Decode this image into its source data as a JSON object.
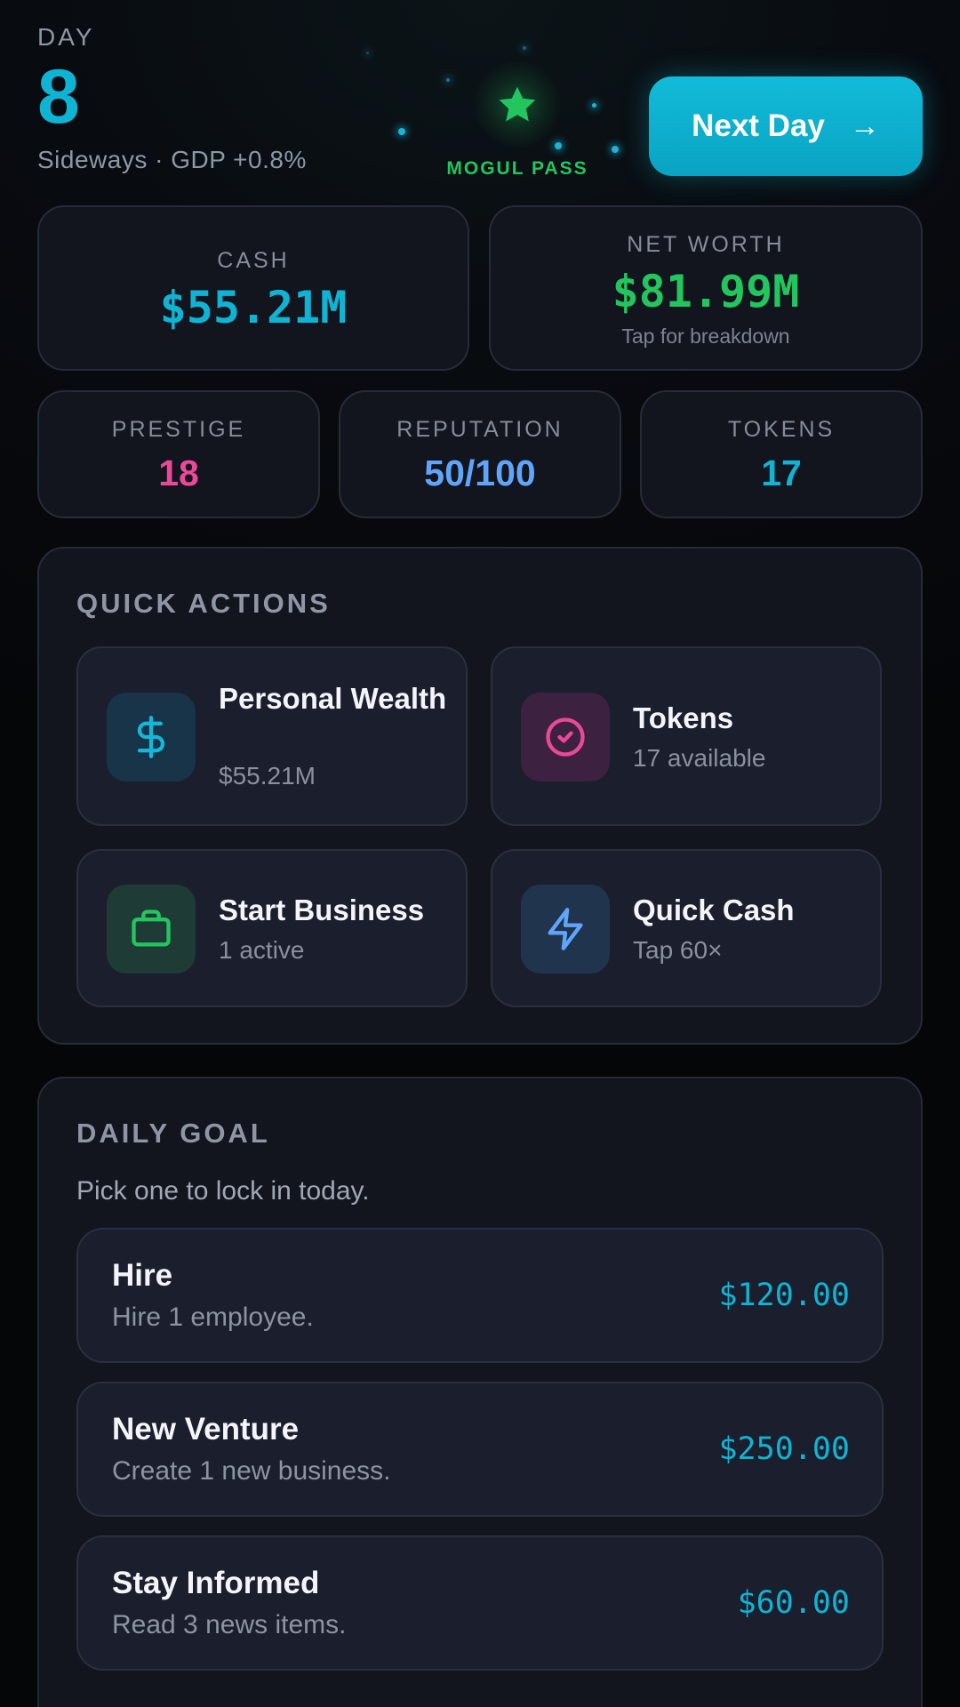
{
  "header": {
    "day_label": "DAY",
    "day_number": "8",
    "market_status": "Sideways · GDP +0.8%",
    "mogul_pass_label": "MOGUL PASS",
    "next_day_label": "Next Day",
    "next_day_arrow": "→"
  },
  "stats": {
    "cash": {
      "label": "CASH",
      "value": "$55.21M"
    },
    "net_worth": {
      "label": "NET WORTH",
      "value": "$81.99M",
      "hint": "Tap for breakdown"
    },
    "prestige": {
      "label": "PRESTIGE",
      "value": "18"
    },
    "reputation": {
      "label": "REPUTATION",
      "value": "50/100"
    },
    "tokens": {
      "label": "TOKENS",
      "value": "17"
    }
  },
  "quick_actions": {
    "title": "QUICK ACTIONS",
    "items": [
      {
        "title": "Personal Wealth",
        "subtitle": "$55.21M",
        "icon": "dollar-icon"
      },
      {
        "title": "Tokens",
        "subtitle": "17 available",
        "icon": "check-circle-icon"
      },
      {
        "title": "Start Business",
        "subtitle": "1 active",
        "icon": "briefcase-icon"
      },
      {
        "title": "Quick Cash",
        "subtitle": "Tap 60×",
        "icon": "lightning-icon"
      }
    ]
  },
  "daily_goal": {
    "title": "DAILY GOAL",
    "subtitle": "Pick one to lock in today.",
    "goals": [
      {
        "title": "Hire",
        "description": "Hire 1 employee.",
        "reward": "$120.00"
      },
      {
        "title": "New Venture",
        "description": "Create 1 new business.",
        "reward": "$250.00"
      },
      {
        "title": "Stay Informed",
        "description": "Read 3 news items.",
        "reward": "$60.00"
      }
    ]
  },
  "colors": {
    "accent_cyan": "#0fb4d4",
    "green": "#22c55e",
    "pink": "#ec4899",
    "blue": "#60a5fa"
  }
}
